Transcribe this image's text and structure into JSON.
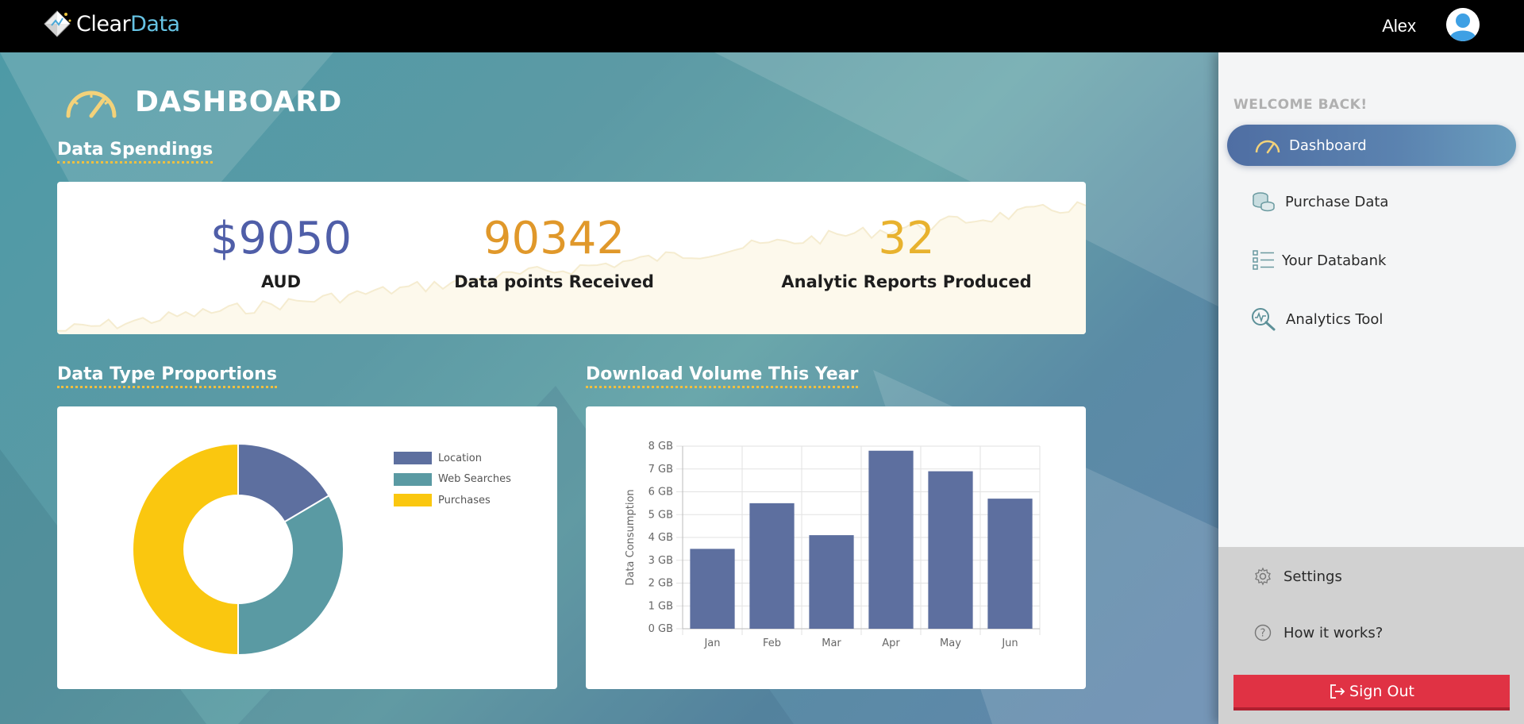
{
  "app": {
    "logo_text_primary": "Clear",
    "logo_text_accent": "Data",
    "user_name": "Alex"
  },
  "page": {
    "title": "DASHBOARD"
  },
  "spendings": {
    "section_title": "Data Spendings",
    "stats": [
      {
        "value": "$9050",
        "label": "AUD",
        "color": "#4f5ea8"
      },
      {
        "value": "90342",
        "label": "Data points Received",
        "color": "#e0982a"
      },
      {
        "value": "32",
        "label": "Analytic Reports Produced",
        "color": "#e8b22e"
      }
    ]
  },
  "proportions": {
    "section_title": "Data Type Proportions",
    "chart_data": {
      "type": "pie",
      "donut": true,
      "labels": [
        "Location",
        "Web Searches",
        "Purchases"
      ],
      "values": [
        16.5,
        33.5,
        50
      ],
      "colors": [
        "#5d6f9f",
        "#5a9aa3",
        "#fac70f"
      ],
      "legend_position": "top-right"
    }
  },
  "downloads": {
    "section_title": "Download Volume This Year",
    "chart_data": {
      "type": "bar",
      "categories": [
        "Jan",
        "Feb",
        "Mar",
        "Apr",
        "May",
        "Jun"
      ],
      "values": [
        3.5,
        5.5,
        4.1,
        7.8,
        6.9,
        5.7
      ],
      "ylabel": "Data Consumption",
      "y_ticks": [
        "0 GB",
        "1 GB",
        "2 GB",
        "3 GB",
        "4 GB",
        "5 GB",
        "6 GB",
        "7 GB",
        "8 GB"
      ],
      "ylim": [
        0,
        8
      ],
      "grid": true,
      "bar_color": "#5d6f9f"
    }
  },
  "sidebar": {
    "welcome": "WELCOME BACK!",
    "items": [
      {
        "label": "Dashboard",
        "icon": "speedometer-icon",
        "active": true
      },
      {
        "label": "Purchase Data",
        "icon": "coins-icon"
      },
      {
        "label": "Your Databank",
        "icon": "list-icon"
      },
      {
        "label": "Analytics Tool",
        "icon": "analytics-search-icon"
      }
    ],
    "lower_items": [
      {
        "label": "Settings",
        "icon": "gear-icon"
      },
      {
        "label": "How it works?",
        "icon": "question-icon"
      }
    ],
    "signout_label": "Sign Out"
  }
}
